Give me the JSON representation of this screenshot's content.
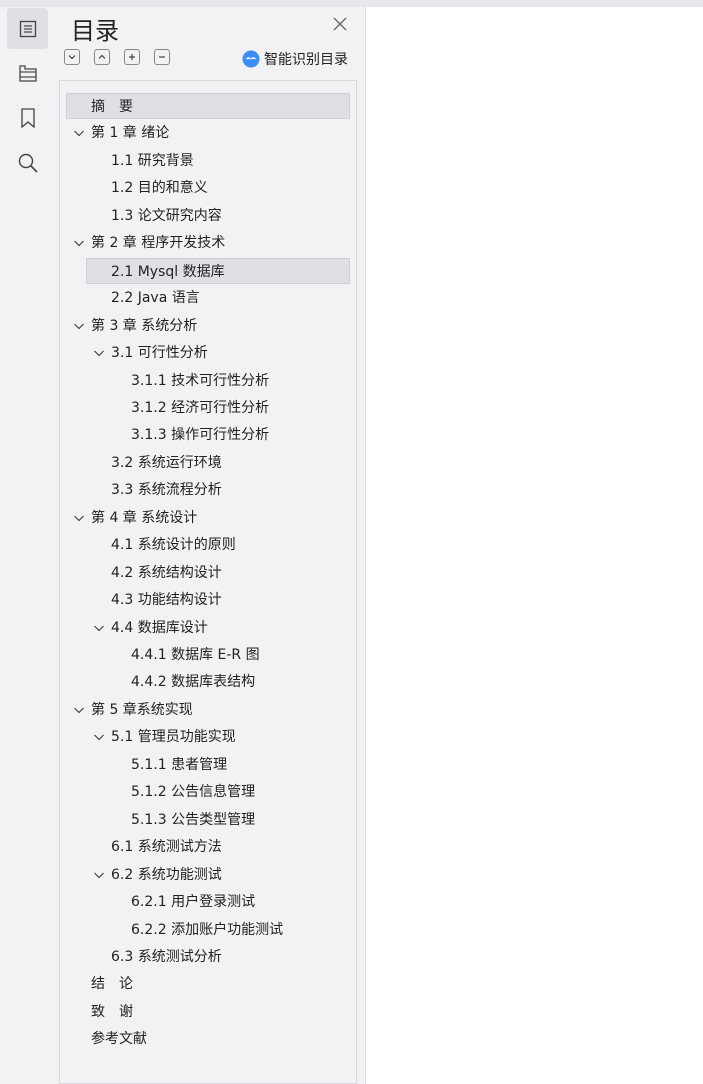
{
  "panel": {
    "title": "目录",
    "smart_label": "智能识别目录"
  },
  "toc": [
    {
      "label": "摘　要",
      "level": 0,
      "expandable": false,
      "selected": true
    },
    {
      "label": "第 1 章  绪论",
      "level": 0,
      "expandable": true
    },
    {
      "label": "1.1  研究背景",
      "level": 1,
      "expandable": false
    },
    {
      "label": "1.2 目的和意义",
      "level": 1,
      "expandable": false
    },
    {
      "label": "1.3  论文研究内容",
      "level": 1,
      "expandable": false
    },
    {
      "label": "第 2 章  程序开发技术",
      "level": 0,
      "expandable": true
    },
    {
      "label": "2.1 Mysql 数据库",
      "level": 1,
      "expandable": false,
      "selected": true
    },
    {
      "label": "2.2 Java 语言",
      "level": 1,
      "expandable": false
    },
    {
      "label": "第 3 章  系统分析",
      "level": 0,
      "expandable": true
    },
    {
      "label": "3.1 可行性分析",
      "level": 1,
      "expandable": true
    },
    {
      "label": "3.1.1 技术可行性分析",
      "level": 2,
      "expandable": false
    },
    {
      "label": "3.1.2 经济可行性分析",
      "level": 2,
      "expandable": false
    },
    {
      "label": "3.1.3 操作可行性分析",
      "level": 2,
      "expandable": false
    },
    {
      "label": "3.2 系统运行环境",
      "level": 1,
      "expandable": false
    },
    {
      "label": "3.3 系统流程分析",
      "level": 1,
      "expandable": false
    },
    {
      "label": "第 4 章  系统设计",
      "level": 0,
      "expandable": true
    },
    {
      "label": "4.1  系统设计的原则",
      "level": 1,
      "expandable": false
    },
    {
      "label": "4.2  系统结构设计",
      "level": 1,
      "expandable": false
    },
    {
      "label": "4.3 功能结构设计",
      "level": 1,
      "expandable": false
    },
    {
      "label": "4.4 数据库设计",
      "level": 1,
      "expandable": true
    },
    {
      "label": "4.4.1  数据库 E-R 图",
      "level": 2,
      "expandable": false
    },
    {
      "label": "4.4.2  数据库表结构",
      "level": 2,
      "expandable": false
    },
    {
      "label": "第 5 章系统实现",
      "level": 0,
      "expandable": true
    },
    {
      "label": "5.1 管理员功能实现",
      "level": 1,
      "expandable": true
    },
    {
      "label": "5.1.1  患者管理",
      "level": 2,
      "expandable": false
    },
    {
      "label": "5.1.2  公告信息管理",
      "level": 2,
      "expandable": false
    },
    {
      "label": "5.1.3 公告类型管理",
      "level": 2,
      "expandable": false
    },
    {
      "label": "6.1 系统测试方法",
      "level": 1,
      "expandable": false
    },
    {
      "label": "6.2  系统功能测试",
      "level": 1,
      "expandable": true
    },
    {
      "label": "6.2.1  用户登录测试",
      "level": 2,
      "expandable": false
    },
    {
      "label": "6.2.2  添加账户功能测试",
      "level": 2,
      "expandable": false
    },
    {
      "label": "6.3  系统测试分析",
      "level": 1,
      "expandable": false
    },
    {
      "label": "结　论",
      "level": 0,
      "expandable": false
    },
    {
      "label": "致　谢",
      "level": 0,
      "expandable": false
    },
    {
      "label": "参考文献",
      "level": 0,
      "expandable": false
    }
  ]
}
